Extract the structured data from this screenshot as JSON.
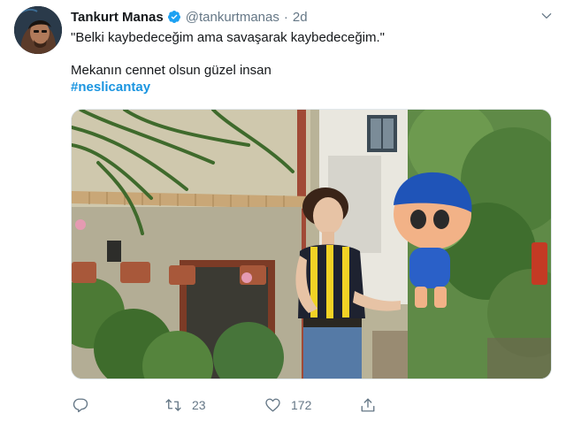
{
  "author": {
    "name": "Tankurt Manas",
    "handle": "@tankurtmanas",
    "separator": "·",
    "time": "2d",
    "verified": true
  },
  "text": {
    "quote": "\"Belki kaybedeceğim ama savaşarak kaybedeceğim.\"",
    "line2": "Mekanın cennet olsun güzel insan",
    "hashtag": "#neslicantay"
  },
  "actions": {
    "reply_count": "",
    "retweet_count": "23",
    "like_count": "172"
  },
  "icons": {
    "reply": "reply-icon",
    "retweet": "retweet-icon",
    "like": "heart-icon",
    "share": "share-icon",
    "menu": "chevron-down-icon",
    "verified": "verified-badge-icon"
  },
  "colors": {
    "text": "#14171a",
    "secondary": "#657786",
    "accent": "#1b95e0",
    "verified": "#1da1f2"
  }
}
